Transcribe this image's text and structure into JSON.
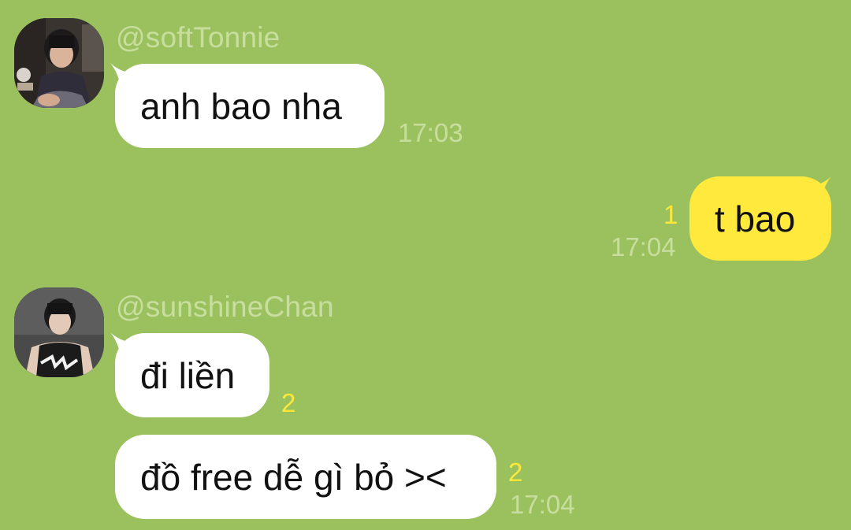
{
  "colors": {
    "background": "#9bc15e",
    "incoming_bubble": "#ffffff",
    "outgoing_bubble": "#fee93c",
    "meta_text": "#c8de9e",
    "unread_count": "#fbe83a"
  },
  "messages": [
    {
      "direction": "incoming",
      "sender": "@softTonnie",
      "avatar_icon": "user-avatar-photo",
      "text": "anh bao nha",
      "time": "17:03"
    },
    {
      "direction": "outgoing",
      "text": "t bao",
      "unread": "1",
      "time": "17:04"
    },
    {
      "direction": "incoming",
      "sender": "@sunshineChan",
      "avatar_icon": "user-avatar-photo",
      "text": "đi liền",
      "unread": "2"
    },
    {
      "direction": "incoming",
      "text": "đồ free dễ gì bỏ ><",
      "unread": "2",
      "time": "17:04"
    }
  ]
}
